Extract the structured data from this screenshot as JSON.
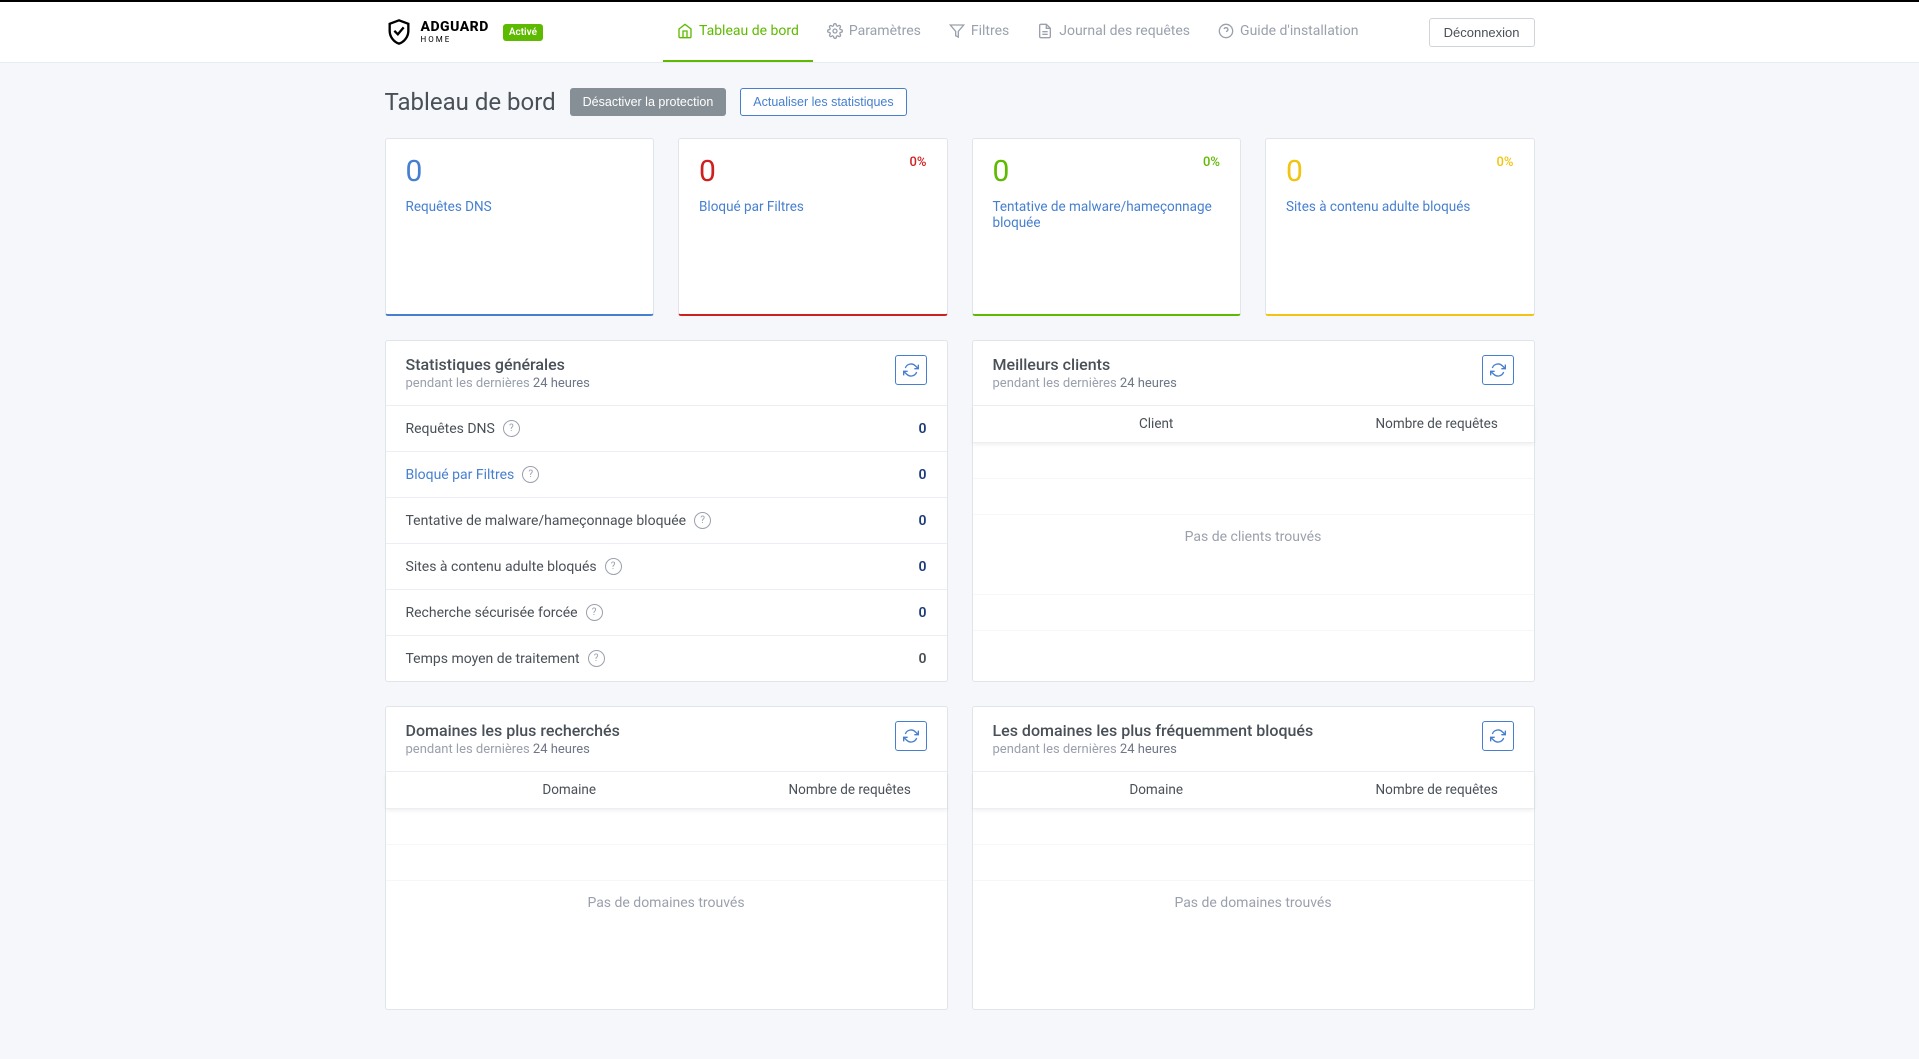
{
  "header": {
    "brand_main": "ADGUARD",
    "brand_sub": "HOME",
    "status_badge": "Activé",
    "logout": "Déconnexion",
    "nav": [
      {
        "label": "Tableau de bord"
      },
      {
        "label": "Paramètres"
      },
      {
        "label": "Filtres"
      },
      {
        "label": "Journal des requêtes"
      },
      {
        "label": "Guide d'installation"
      }
    ]
  },
  "page": {
    "title": "Tableau de bord",
    "disable_btn": "Désactiver la protection",
    "refresh_btn": "Actualiser les statistiques"
  },
  "cards": [
    {
      "value": "0",
      "label": "Requêtes DNS",
      "pct": ""
    },
    {
      "value": "0",
      "label": "Bloqué par Filtres",
      "pct": "0%"
    },
    {
      "value": "0",
      "label": "Tentative de malware/hameçonnage bloquée",
      "pct": "0%"
    },
    {
      "value": "0",
      "label": "Sites à contenu adulte bloqués",
      "pct": "0%"
    }
  ],
  "general_stats": {
    "title": "Statistiques générales",
    "sub_prefix": "pendant les dernières ",
    "sub_period": "24 heures",
    "rows": [
      {
        "label": "Requêtes DNS",
        "value": "0"
      },
      {
        "label": "Bloqué par Filtres",
        "value": "0"
      },
      {
        "label": "Tentative de malware/hameçonnage bloquée",
        "value": "0"
      },
      {
        "label": "Sites à contenu adulte bloqués",
        "value": "0"
      },
      {
        "label": "Recherche sécurisée forcée",
        "value": "0"
      },
      {
        "label": "Temps moyen de traitement",
        "value": "0"
      }
    ]
  },
  "top_clients": {
    "title": "Meilleurs clients",
    "sub_prefix": "pendant les dernières ",
    "sub_period": "24 heures",
    "col1": "Client",
    "col2": "Nombre de requêtes",
    "empty": "Pas de clients trouvés"
  },
  "top_queried": {
    "title": "Domaines les plus recherchés",
    "sub_prefix": "pendant les dernières ",
    "sub_period": "24 heures",
    "col1": "Domaine",
    "col2": "Nombre de requêtes",
    "empty": "Pas de domaines trouvés"
  },
  "top_blocked": {
    "title": "Les domaines les plus fréquemment bloqués",
    "sub_prefix": "pendant les dernières ",
    "sub_period": "24 heures",
    "col1": "Domaine",
    "col2": "Nombre de requêtes",
    "empty": "Pas de domaines trouvés"
  }
}
